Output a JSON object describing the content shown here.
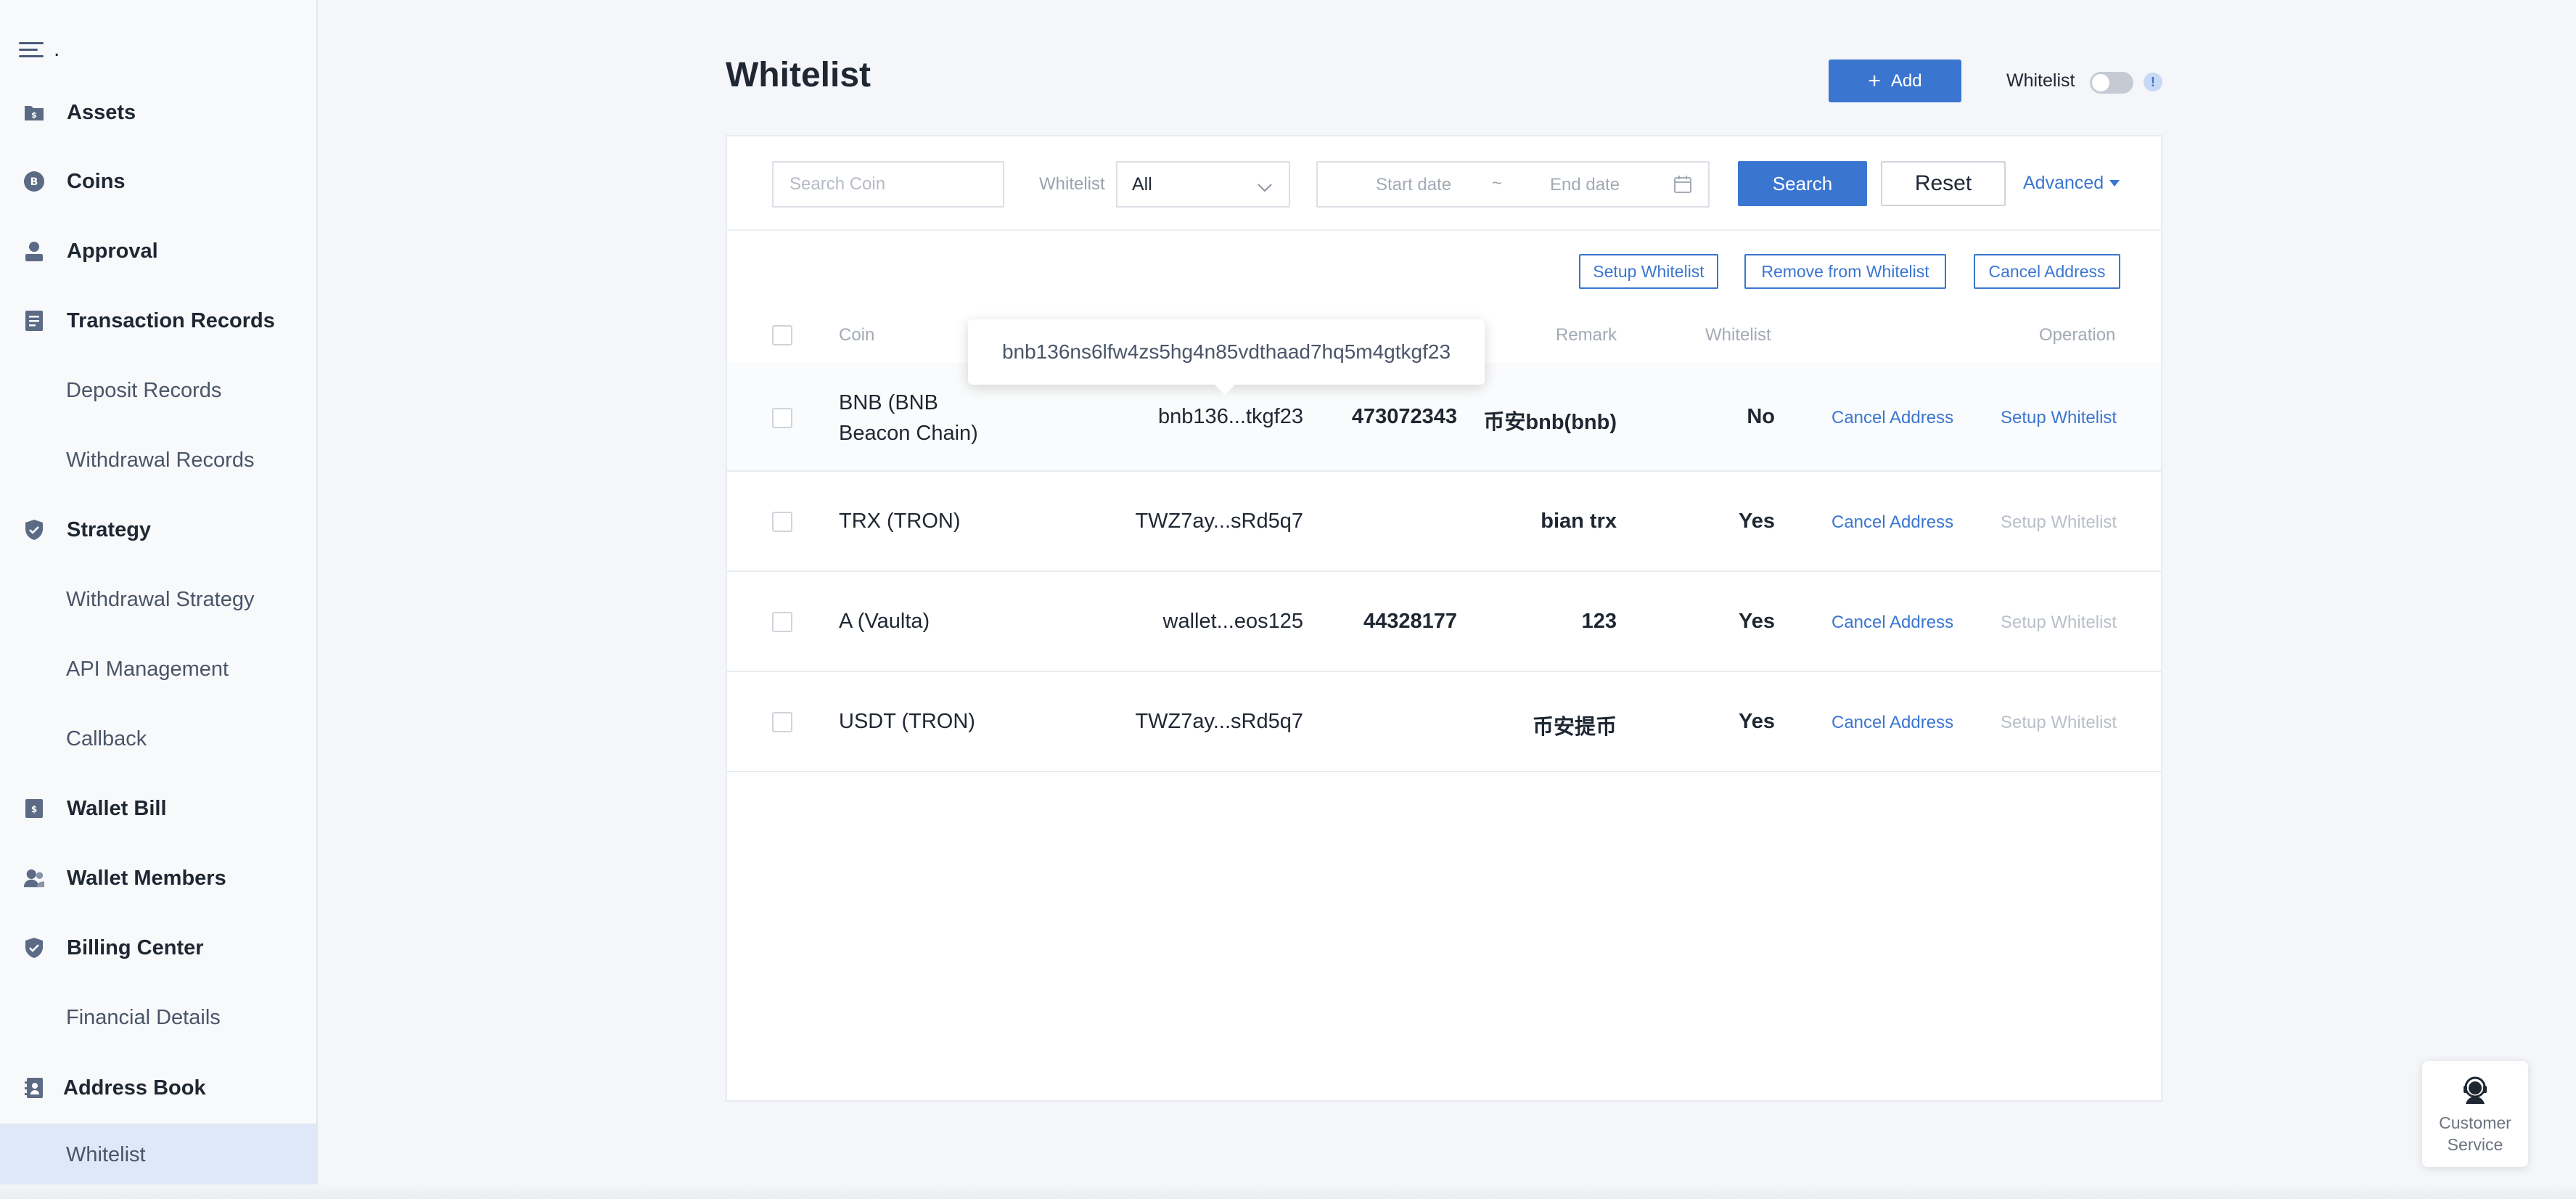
{
  "sidebar": {
    "top_label": ".",
    "items": [
      {
        "label": "Assets",
        "type": "main",
        "icon": "assets-icon"
      },
      {
        "label": "Coins",
        "type": "main",
        "icon": "coins-icon"
      },
      {
        "label": "Approval",
        "type": "main",
        "icon": "approval-icon"
      },
      {
        "label": "Transaction Records",
        "type": "main",
        "icon": "transaction-records-icon"
      },
      {
        "label": "Deposit Records",
        "type": "sub"
      },
      {
        "label": "Withdrawal Records",
        "type": "sub"
      },
      {
        "label": "Strategy",
        "type": "main",
        "icon": "strategy-shield-icon"
      },
      {
        "label": "Withdrawal Strategy",
        "type": "sub"
      },
      {
        "label": "API Management",
        "type": "sub"
      },
      {
        "label": "Callback",
        "type": "sub"
      },
      {
        "label": "Wallet Bill",
        "type": "main",
        "icon": "wallet-bill-icon"
      },
      {
        "label": "Wallet Members",
        "type": "main",
        "icon": "wallet-members-icon"
      },
      {
        "label": "Billing Center",
        "type": "main",
        "icon": "billing-center-icon"
      },
      {
        "label": "Financial Details",
        "type": "sub"
      },
      {
        "label": "Address Book",
        "type": "main",
        "icon": "address-book-icon"
      },
      {
        "label": "Whitelist",
        "type": "sub",
        "active": true
      }
    ]
  },
  "header": {
    "title": "Whitelist",
    "add_label": "Add",
    "whitelist_toggle_label": "Whitelist",
    "whitelist_toggle_on": false,
    "info_badge": "!"
  },
  "filters": {
    "search_placeholder": "Search Coin",
    "whitelist_label": "Whitelist",
    "whitelist_value": "All",
    "start_date_placeholder": "Start date",
    "date_separator": "~",
    "end_date_placeholder": "End date",
    "search_label": "Search",
    "reset_label": "Reset",
    "advanced_label": "Advanced"
  },
  "actions": {
    "setup_whitelist": "Setup Whitelist",
    "remove_from_whitelist": "Remove from Whitelist",
    "cancel_address": "Cancel Address"
  },
  "table": {
    "columns": {
      "coin": "Coin",
      "remark": "Remark",
      "whitelist": "Whitelist",
      "operation": "Operation"
    },
    "rows": [
      {
        "coin_line1": "BNB (BNB",
        "coin_line2": "Beacon Chain)",
        "address": "bnb136...tkgf23",
        "memo": "473072343",
        "remark": "币安bnb(bnb)",
        "whitelist": "No",
        "op_cancel": "Cancel Address",
        "op_setup": "Setup Whitelist",
        "setup_enabled": true
      },
      {
        "coin_line1": "TRX (TRON)",
        "coin_line2": "",
        "address": "TWZ7ay...sRd5q7",
        "memo": "",
        "remark": "bian trx",
        "whitelist": "Yes",
        "op_cancel": "Cancel Address",
        "op_setup": "Setup Whitelist",
        "setup_enabled": false
      },
      {
        "coin_line1": "A (Vaulta)",
        "coin_line2": "",
        "address": "wallet...eos125",
        "memo": "44328177",
        "remark": "123",
        "whitelist": "Yes",
        "op_cancel": "Cancel Address",
        "op_setup": "Setup Whitelist",
        "setup_enabled": false
      },
      {
        "coin_line1": "USDT (TRON)",
        "coin_line2": "",
        "address": "TWZ7ay...sRd5q7",
        "memo": "",
        "remark": "币安提币",
        "whitelist": "Yes",
        "op_cancel": "Cancel Address",
        "op_setup": "Setup Whitelist",
        "setup_enabled": false
      }
    ]
  },
  "tooltip": {
    "text": "bnb136ns6lfw4zs5hg4n85vdthaad7hq5m4gtkgf23"
  },
  "customer_service": {
    "line1": "Customer",
    "line2": "Service"
  },
  "colors": {
    "primary": "#3a76d0",
    "active_nav_bg": "#dfe8f7",
    "disabled_text": "#b9bfc8"
  }
}
